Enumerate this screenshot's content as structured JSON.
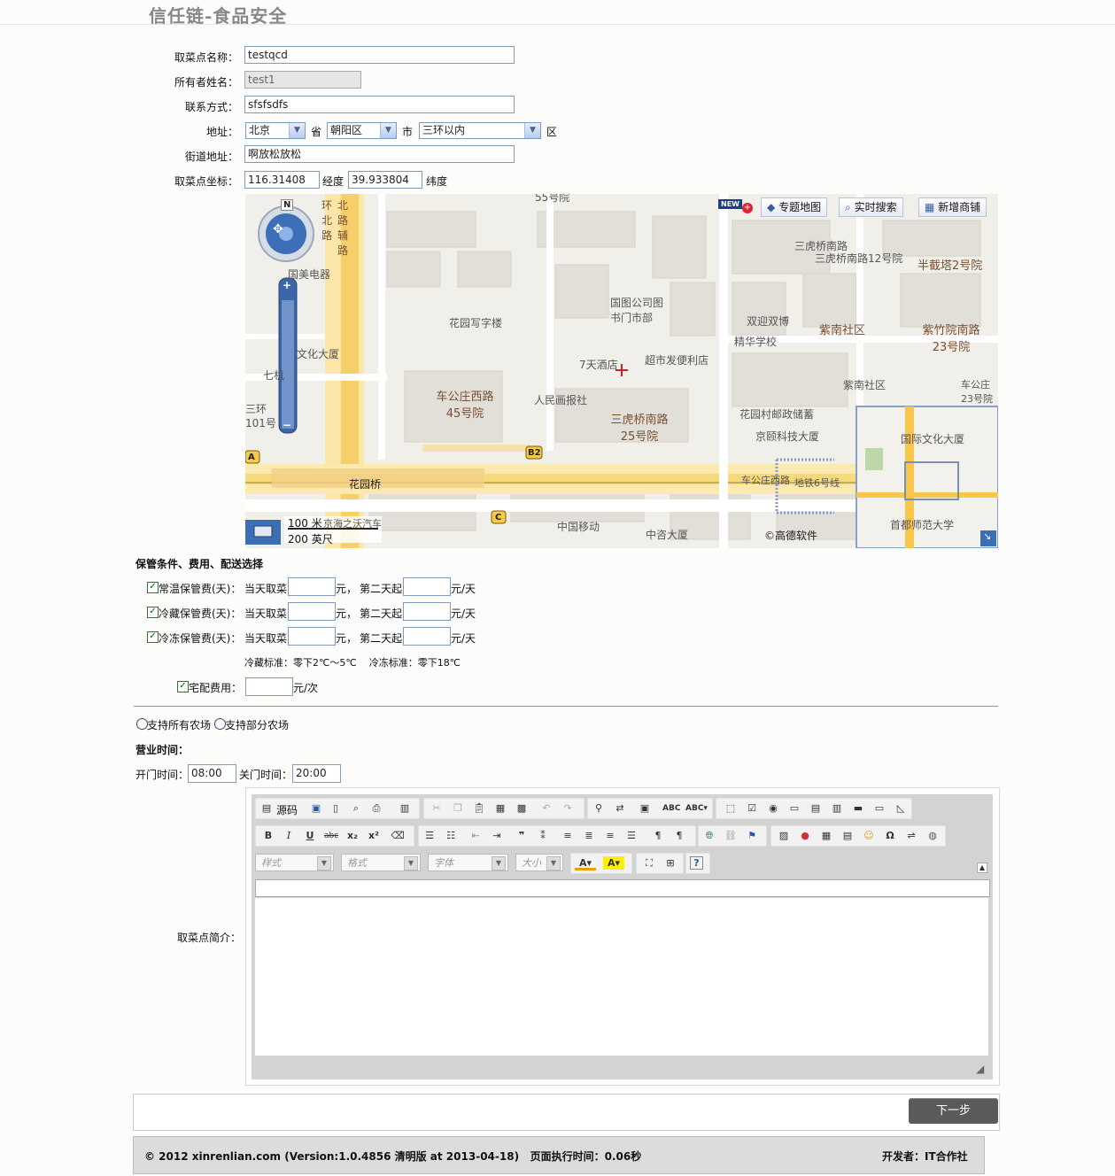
{
  "header": {
    "title": "信任链-食品安全"
  },
  "form": {
    "name_label": "取菜点名称：",
    "name_value": "testqcd",
    "owner_label": "所有者姓名：",
    "owner_value": "test1",
    "contact_label": "联系方式：",
    "contact_value": "sfsfsdfs",
    "address_label": "地址：",
    "province_value": "北京",
    "province_suffix": "省",
    "city_value": "朝阳区",
    "city_suffix": "市",
    "district_value": "三环以内",
    "district_suffix": "区",
    "street_label": "街道地址：",
    "street_value": "啊放松放松",
    "coord_label": "取菜点坐标：",
    "lng_value": "116.31408",
    "lng_unit": "经度",
    "lat_value": "39.933804",
    "lat_unit": "纬度"
  },
  "map": {
    "tools": [
      "专题地图",
      "实时搜索",
      "新增商铺"
    ],
    "new_badge": "NEW",
    "compass_n": "N",
    "labels": [
      "55号院",
      "三虎桥南路",
      "三虎桥南路12号院",
      "半截塔2号院",
      "国美电器",
      "国图公司图书门市部",
      "花园写字楼",
      "双迎双博",
      "精华学校",
      "紫南社区",
      "紫竹院南路23号院",
      "文化大厦",
      "7天酒店",
      "超市发便利店",
      "紫南社区",
      "车公庄西路45号院",
      "人民画报社",
      "三虎桥南路25号院",
      "花园村邮政储蓄",
      "京颐科技大厦",
      "国际文化大厦",
      "花园桥",
      "车公庄西路",
      "地铁6号线",
      "中国移动",
      "中咨大厦",
      "首都师范大学",
      "车公庄23号院",
      "京海之沃汽车",
      "七机",
      "三环",
      "101号"
    ],
    "scale_metric": "100 米",
    "scale_imperial": "200 英尺",
    "copyright": "©高德软件",
    "road_labels": [
      "环北路",
      "北路辅路"
    ],
    "markers": [
      "A",
      "B2",
      "C"
    ]
  },
  "storage": {
    "section_title": "保管条件、费用、配送选择",
    "rows": [
      {
        "label": "常温保管费(天)：",
        "today": "当天取菜",
        "yuan": "元，",
        "second": "第二天起",
        "per_day": "元/天",
        "checked": true
      },
      {
        "label": "冷藏保管费(天)：",
        "today": "当天取菜",
        "yuan": "元，",
        "second": "第二天起",
        "per_day": "元/天",
        "checked": true
      },
      {
        "label": "冷冻保管费(天)：",
        "today": "当天取菜",
        "yuan": "元，",
        "second": "第二天起",
        "per_day": "元/天",
        "checked": true
      }
    ],
    "standard_note": "冷藏标准：零下2℃～5℃    冷冻标准：零下18℃",
    "delivery_label": "宅配费用：",
    "delivery_unit": "元/次"
  },
  "farms": {
    "option_all": "支持所有农场",
    "option_some": "支持部分农场"
  },
  "hours": {
    "title": "营业时间：",
    "open_label": "开门时间：",
    "open_value": "08:00",
    "close_label": "关门时间：",
    "close_value": "20:00"
  },
  "editor": {
    "label": "取菜点简介：",
    "source_label": "源码",
    "style_placeholder": "样式",
    "format_placeholder": "格式",
    "font_placeholder": "字体",
    "size_placeholder": "大小"
  },
  "actions": {
    "next_label": "下一步"
  },
  "footer": {
    "copyright": "© 2012 xinrenlian.com (Version:1.0.4856 清明版 at 2013-04-18)   页面执行时间：0.06秒",
    "developer": "开发者：IT合作社"
  }
}
